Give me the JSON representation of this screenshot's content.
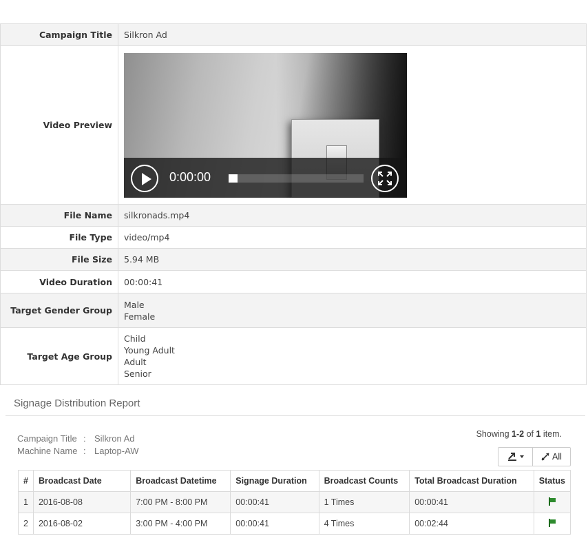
{
  "details": {
    "campaign_title_label": "Campaign Title",
    "campaign_title": "Silkron Ad",
    "video_preview_label": "Video Preview",
    "video_time": "0:00:00",
    "file_name_label": "File Name",
    "file_name": "silkronads.mp4",
    "file_type_label": "File Type",
    "file_type": "video/mp4",
    "file_size_label": "File Size",
    "file_size": "5.94 MB",
    "video_duration_label": "Video Duration",
    "video_duration": "00:00:41",
    "gender_label": "Target Gender Group",
    "genders": [
      "Male",
      "Female"
    ],
    "age_label": "Target Age Group",
    "ages": [
      "Child",
      "Young Adult",
      "Adult",
      "Senior"
    ]
  },
  "report": {
    "section_title": "Signage Distribution Report",
    "campaign_title_key": "Campaign Title",
    "campaign_title_value": "Silkron Ad",
    "machine_name_key": "Machine Name",
    "machine_name_value": "Laptop-AW",
    "separator": ":",
    "summary_prefix": "Showing ",
    "summary_range": "1-2",
    "summary_of": " of ",
    "summary_total": "1",
    "summary_suffix": " item.",
    "all_label": "All",
    "columns": [
      "#",
      "Broadcast Date",
      "Broadcast Datetime",
      "Signage Duration",
      "Broadcast Counts",
      "Total Broadcast Duration",
      "Status"
    ],
    "rows": [
      {
        "num": "1",
        "date": "2016-08-08",
        "datetime": "7:00 PM - 8:00 PM",
        "duration": "00:00:41",
        "counts": "1 Times",
        "total": "00:00:41",
        "status": "flag-icon"
      },
      {
        "num": "2",
        "date": "2016-08-02",
        "datetime": "3:00 PM - 4:00 PM",
        "duration": "00:00:41",
        "counts": "4 Times",
        "total": "00:02:44",
        "status": "flag-icon"
      }
    ],
    "status_color": "#2e8b2e"
  }
}
